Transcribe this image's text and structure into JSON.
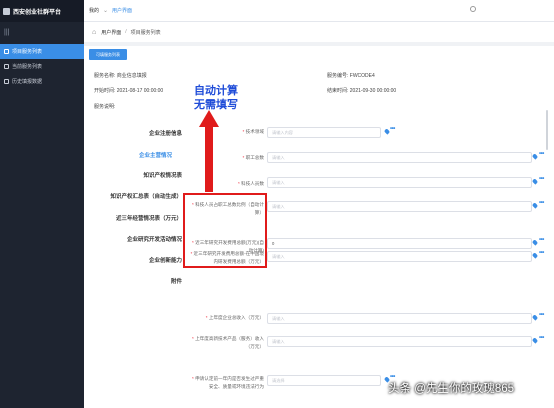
{
  "sidebar": {
    "brand": "西安创业社群平台",
    "collapse_icon": "menu-lines-icon",
    "items": [
      {
        "label": "项目服务列表",
        "icon": "grid-icon",
        "active": true
      },
      {
        "label": "当前服务列表",
        "icon": "grid-icon",
        "active": false
      },
      {
        "label": "历史填报数据",
        "icon": "grid-icon",
        "active": false
      }
    ]
  },
  "topbar": {
    "home": "我的",
    "current": "用户界面"
  },
  "breadcrumb": {
    "home_icon": "home-icon",
    "items": [
      "用户界面",
      "项目服务列表"
    ]
  },
  "main": {
    "add_button": "可填服务列表",
    "service_name_label": "服务名称:",
    "service_name": "商业信息填报",
    "service_no_label": "服务编号:",
    "service_no": "FWCODE4",
    "start_label": "开始时间:",
    "start_time": "2021-08-17 00:00:00",
    "end_label": "结束时间:",
    "end_time": "2021-09-30 00:00:00",
    "desc_label": "服务说明:"
  },
  "form_nav": [
    {
      "label": "企业注册信息",
      "active": false
    },
    {
      "label": "企业主营情况",
      "active": true
    },
    {
      "label": "知识产权情况表",
      "active": false
    },
    {
      "label": "知识产权汇总表（自动生成）",
      "active": false
    },
    {
      "label": "近三年经营情况表（万元）",
      "active": false
    },
    {
      "label": "企业研究开发活动情况",
      "active": false
    },
    {
      "label": "企业创新能力",
      "active": false
    },
    {
      "label": "附件",
      "active": false
    }
  ],
  "form_fields": [
    {
      "label": "技术领域",
      "value": "",
      "placeholder": "请输入内容",
      "type": "select"
    },
    {
      "label": "职工总数",
      "value": "",
      "placeholder": "请输入"
    },
    {
      "label": "科技人员数",
      "value": "",
      "placeholder": "请输入"
    },
    {
      "label": "科技人员占职工总数比例（自动计算）",
      "value": "",
      "placeholder": "请输入"
    },
    {
      "label": "近三年研究开发费用总额(万元)(自动计算)",
      "value": "0",
      "placeholder": ""
    },
    {
      "label": "近三年研究开发费用总额-在中国境内研发费用总额（万元）",
      "value": "",
      "placeholder": "请输入"
    },
    {
      "label": "上年度企业总收入（万元）",
      "value": "",
      "placeholder": "请输入"
    },
    {
      "label": "上年度高新技术产品（服务）收入（万元）",
      "value": "",
      "placeholder": "请输入"
    },
    {
      "label": "申请认定前一年内是否发生过严重安全、质量或环境违法行为",
      "value": "",
      "placeholder": "请选择",
      "type": "select"
    }
  ],
  "annotation": {
    "line1": "自动计算",
    "line2": "无需填写",
    "color": "#e01b1b"
  },
  "watermark": "头条 @先生你的玫瑰865",
  "colors": {
    "accent": "#3a8ee6",
    "sidebar": "#1e2430",
    "annotation_text": "#1f4cd8"
  }
}
